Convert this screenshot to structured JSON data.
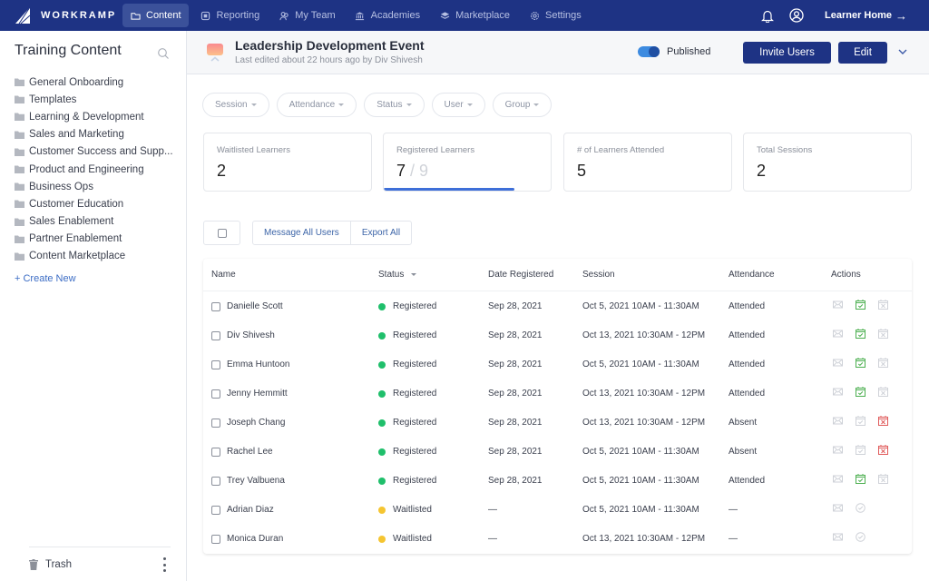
{
  "nav": {
    "logo": "WORKRAMP",
    "items": [
      {
        "label": "Content",
        "icon": "folder-icon",
        "active": true
      },
      {
        "label": "Reporting",
        "icon": "reporting-icon",
        "active": false
      },
      {
        "label": "My Team",
        "icon": "team-icon",
        "active": false
      },
      {
        "label": "Academies",
        "icon": "academies-icon",
        "active": false
      },
      {
        "label": "Marketplace",
        "icon": "marketplace-icon",
        "active": false
      },
      {
        "label": "Settings",
        "icon": "gear-icon",
        "active": false
      }
    ],
    "learner_home": "Learner Home",
    "learner_home_arrow": "→"
  },
  "sidebar": {
    "title": "Training Content",
    "items": [
      {
        "label": "General Onboarding"
      },
      {
        "label": "Templates"
      },
      {
        "label": "Learning & Development"
      },
      {
        "label": "Sales and Marketing"
      },
      {
        "label": "Customer Success and Supp..."
      },
      {
        "label": "Product and Engineering"
      },
      {
        "label": "Business Ops"
      },
      {
        "label": "Customer Education"
      },
      {
        "label": "Sales Enablement"
      },
      {
        "label": "Partner Enablement"
      },
      {
        "label": "Content Marketplace"
      }
    ],
    "create_new": "+ Create New",
    "trash": "Trash"
  },
  "header": {
    "title": "Leadership Development Event",
    "subtitle": "Last edited about 22 hours ago by Div Shivesh",
    "published_label": "Published",
    "published": true,
    "invite_button": "Invite Users",
    "edit_button": "Edit"
  },
  "filters": [
    {
      "label": "Session"
    },
    {
      "label": "Attendance"
    },
    {
      "label": "Status"
    },
    {
      "label": "User"
    },
    {
      "label": "Group"
    }
  ],
  "stats": {
    "waitlisted": {
      "label": "Waitlisted Learners",
      "value": "2"
    },
    "registered": {
      "label": "Registered Learners",
      "value": "7",
      "total": "/ 9",
      "fraction": 0.78
    },
    "attended": {
      "label": "# of Learners Attended",
      "value": "5"
    },
    "sessions": {
      "label": "Total Sessions",
      "value": "2"
    }
  },
  "bulk": {
    "message_all": "Message All Users",
    "export_all": "Export All"
  },
  "colors": {
    "brand": "#1e3384",
    "registered": "#1fbf6b",
    "waitlisted": "#f5c531",
    "attended_icon": "#4caf50",
    "absent_icon": "#e05a5a"
  },
  "table": {
    "columns": {
      "name": "Name",
      "status": "Status",
      "date": "Date Registered",
      "session": "Session",
      "attendance": "Attendance",
      "actions": "Actions"
    },
    "rows": [
      {
        "name": "Danielle Scott",
        "status": "Registered",
        "date": "Sep 28, 2021",
        "session": "Oct 5, 2021 10AM - 11:30AM",
        "attendance": "Attended"
      },
      {
        "name": "Div Shivesh",
        "status": "Registered",
        "date": "Sep 28, 2021",
        "session": "Oct 13, 2021 10:30AM - 12PM",
        "attendance": "Attended"
      },
      {
        "name": "Emma Huntoon",
        "status": "Registered",
        "date": "Sep 28, 2021",
        "session": "Oct 5, 2021 10AM - 11:30AM",
        "attendance": "Attended"
      },
      {
        "name": "Jenny Hemmitt",
        "status": "Registered",
        "date": "Sep 28, 2021",
        "session": "Oct 13, 2021 10:30AM - 12PM",
        "attendance": "Attended"
      },
      {
        "name": "Joseph Chang",
        "status": "Registered",
        "date": "Sep 28, 2021",
        "session": "Oct 13, 2021 10:30AM - 12PM",
        "attendance": "Absent"
      },
      {
        "name": "Rachel Lee",
        "status": "Registered",
        "date": "Sep 28, 2021",
        "session": "Oct 5, 2021 10AM - 11:30AM",
        "attendance": "Absent"
      },
      {
        "name": "Trey Valbuena",
        "status": "Registered",
        "date": "Sep 28, 2021",
        "session": "Oct 5, 2021 10AM - 11:30AM",
        "attendance": "Attended"
      },
      {
        "name": "Adrian Diaz",
        "status": "Waitlisted",
        "date": "—",
        "session": "Oct 5, 2021 10AM - 11:30AM",
        "attendance": "—"
      },
      {
        "name": "Monica Duran",
        "status": "Waitlisted",
        "date": "—",
        "session": "Oct 13, 2021 10:30AM - 12PM",
        "attendance": "—"
      }
    ]
  }
}
